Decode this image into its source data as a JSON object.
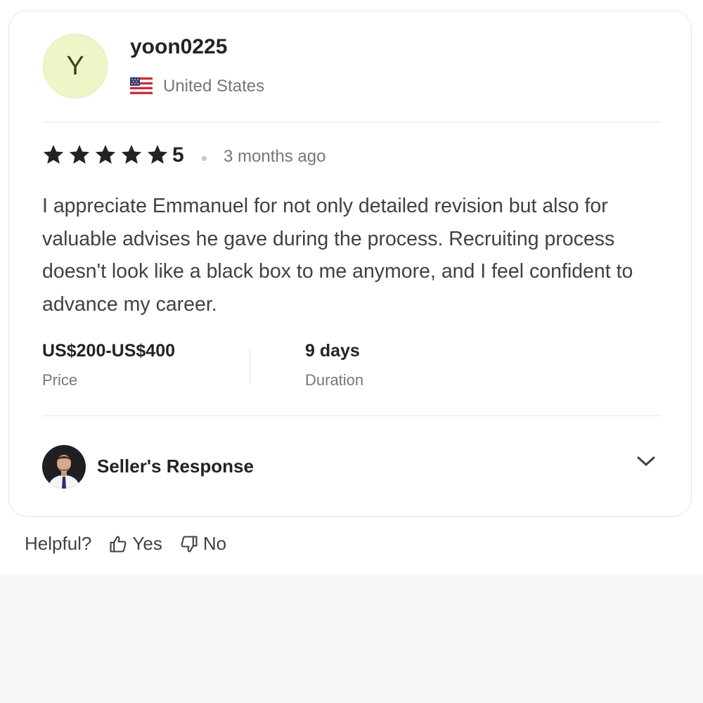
{
  "reviewer": {
    "avatar_initial": "Y",
    "username": "yoon0225",
    "country": "United States",
    "flag_icon": "us-flag-icon"
  },
  "review": {
    "star_count": 5,
    "rating": "5",
    "time_ago": "3 months ago",
    "text": "I appreciate Emmanuel for not only detailed revision but also for valuable advises he gave during the process. Recruiting process doesn't look like a black box to me anymore, and I feel confident to advance my career."
  },
  "meta": {
    "price_value": "US$200-US$400",
    "price_label": "Price",
    "duration_value": "9 days",
    "duration_label": "Duration"
  },
  "seller_response": {
    "label": "Seller's Response",
    "expand_icon": "chevron-down-icon"
  },
  "helpful": {
    "label": "Helpful?",
    "yes_label": "Yes",
    "no_label": "No",
    "yes_icon": "thumbs-up-icon",
    "no_icon": "thumbs-down-icon"
  },
  "colors": {
    "avatar_bg": "#f0f5c8",
    "text_primary": "#222325",
    "text_secondary": "#74767e",
    "border": "#e4e5e7",
    "page_bottom_bg": "#f6f6f8"
  }
}
